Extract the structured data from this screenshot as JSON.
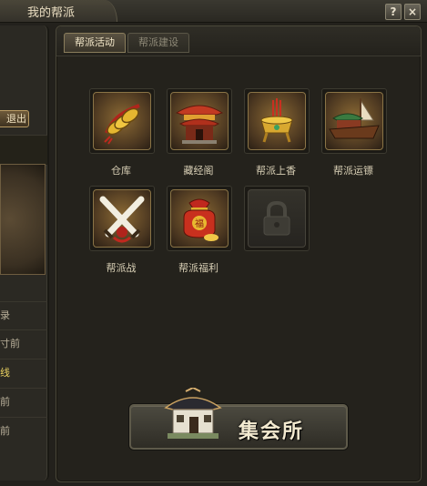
{
  "window": {
    "title": "我的帮派",
    "help_label": "?",
    "close_label": "×"
  },
  "left": {
    "exit_label": "退出",
    "rows": [
      "录",
      "寸前",
      "线",
      "前",
      "前"
    ]
  },
  "tabs": [
    {
      "label": "帮派活动",
      "active": true
    },
    {
      "label": "帮派建设",
      "active": false
    }
  ],
  "features": [
    {
      "label": "仓库",
      "icon": "treasure-coin-icon"
    },
    {
      "label": "藏经阁",
      "icon": "pavilion-icon"
    },
    {
      "label": "帮派上香",
      "icon": "incense-burner-icon"
    },
    {
      "label": "帮派运镖",
      "icon": "escort-ship-icon"
    },
    {
      "label": "帮派战",
      "icon": "crossed-swords-icon"
    },
    {
      "label": "帮派福利",
      "icon": "lucky-bag-icon"
    },
    {
      "label": "",
      "icon": "lock-icon",
      "locked": true
    }
  ],
  "gather": {
    "label": "集会所"
  },
  "colors": {
    "accent": "#8a7446",
    "active_row": "#e8d060"
  }
}
